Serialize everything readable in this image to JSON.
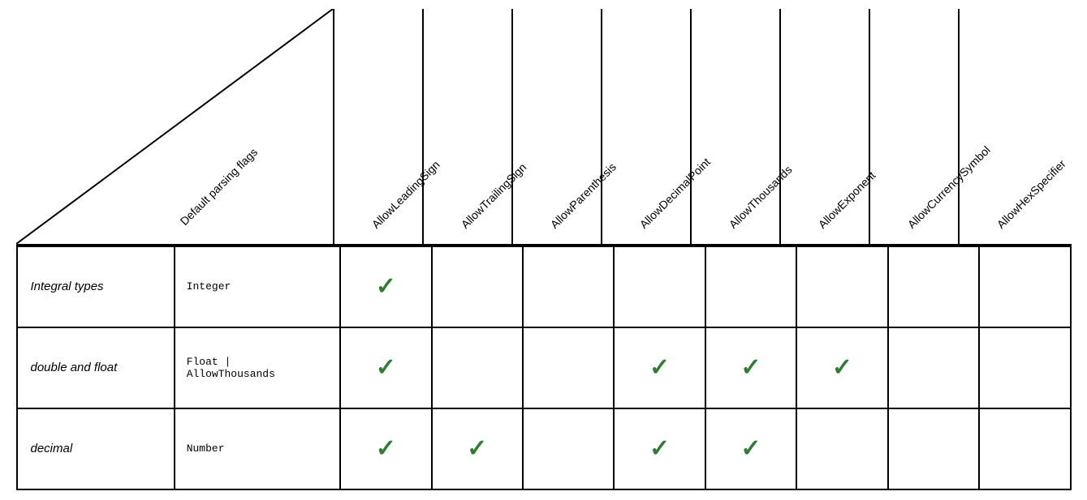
{
  "header": {
    "empty_left": "",
    "default_flags": "Default parsing flags",
    "columns": [
      "AllowLeadingSign",
      "AllowTrailingSign",
      "AllowParenthesis",
      "AllowDecimalPoint",
      "AllowThousands",
      "AllowExponent",
      "AllowCurrencySymbol",
      "AllowHexSpecifier"
    ]
  },
  "rows": [
    {
      "row_label": "Integral types",
      "default_flags": "Integer",
      "checks": [
        true,
        false,
        false,
        false,
        false,
        false,
        false,
        false
      ]
    },
    {
      "row_label": "double and float",
      "default_flags": "Float |\nAllowThousands",
      "checks": [
        true,
        false,
        false,
        true,
        true,
        true,
        false,
        false
      ]
    },
    {
      "row_label": "decimal",
      "default_flags": "Number",
      "checks": [
        true,
        true,
        false,
        true,
        true,
        false,
        false,
        false
      ]
    }
  ],
  "checkmark_symbol": "✓"
}
